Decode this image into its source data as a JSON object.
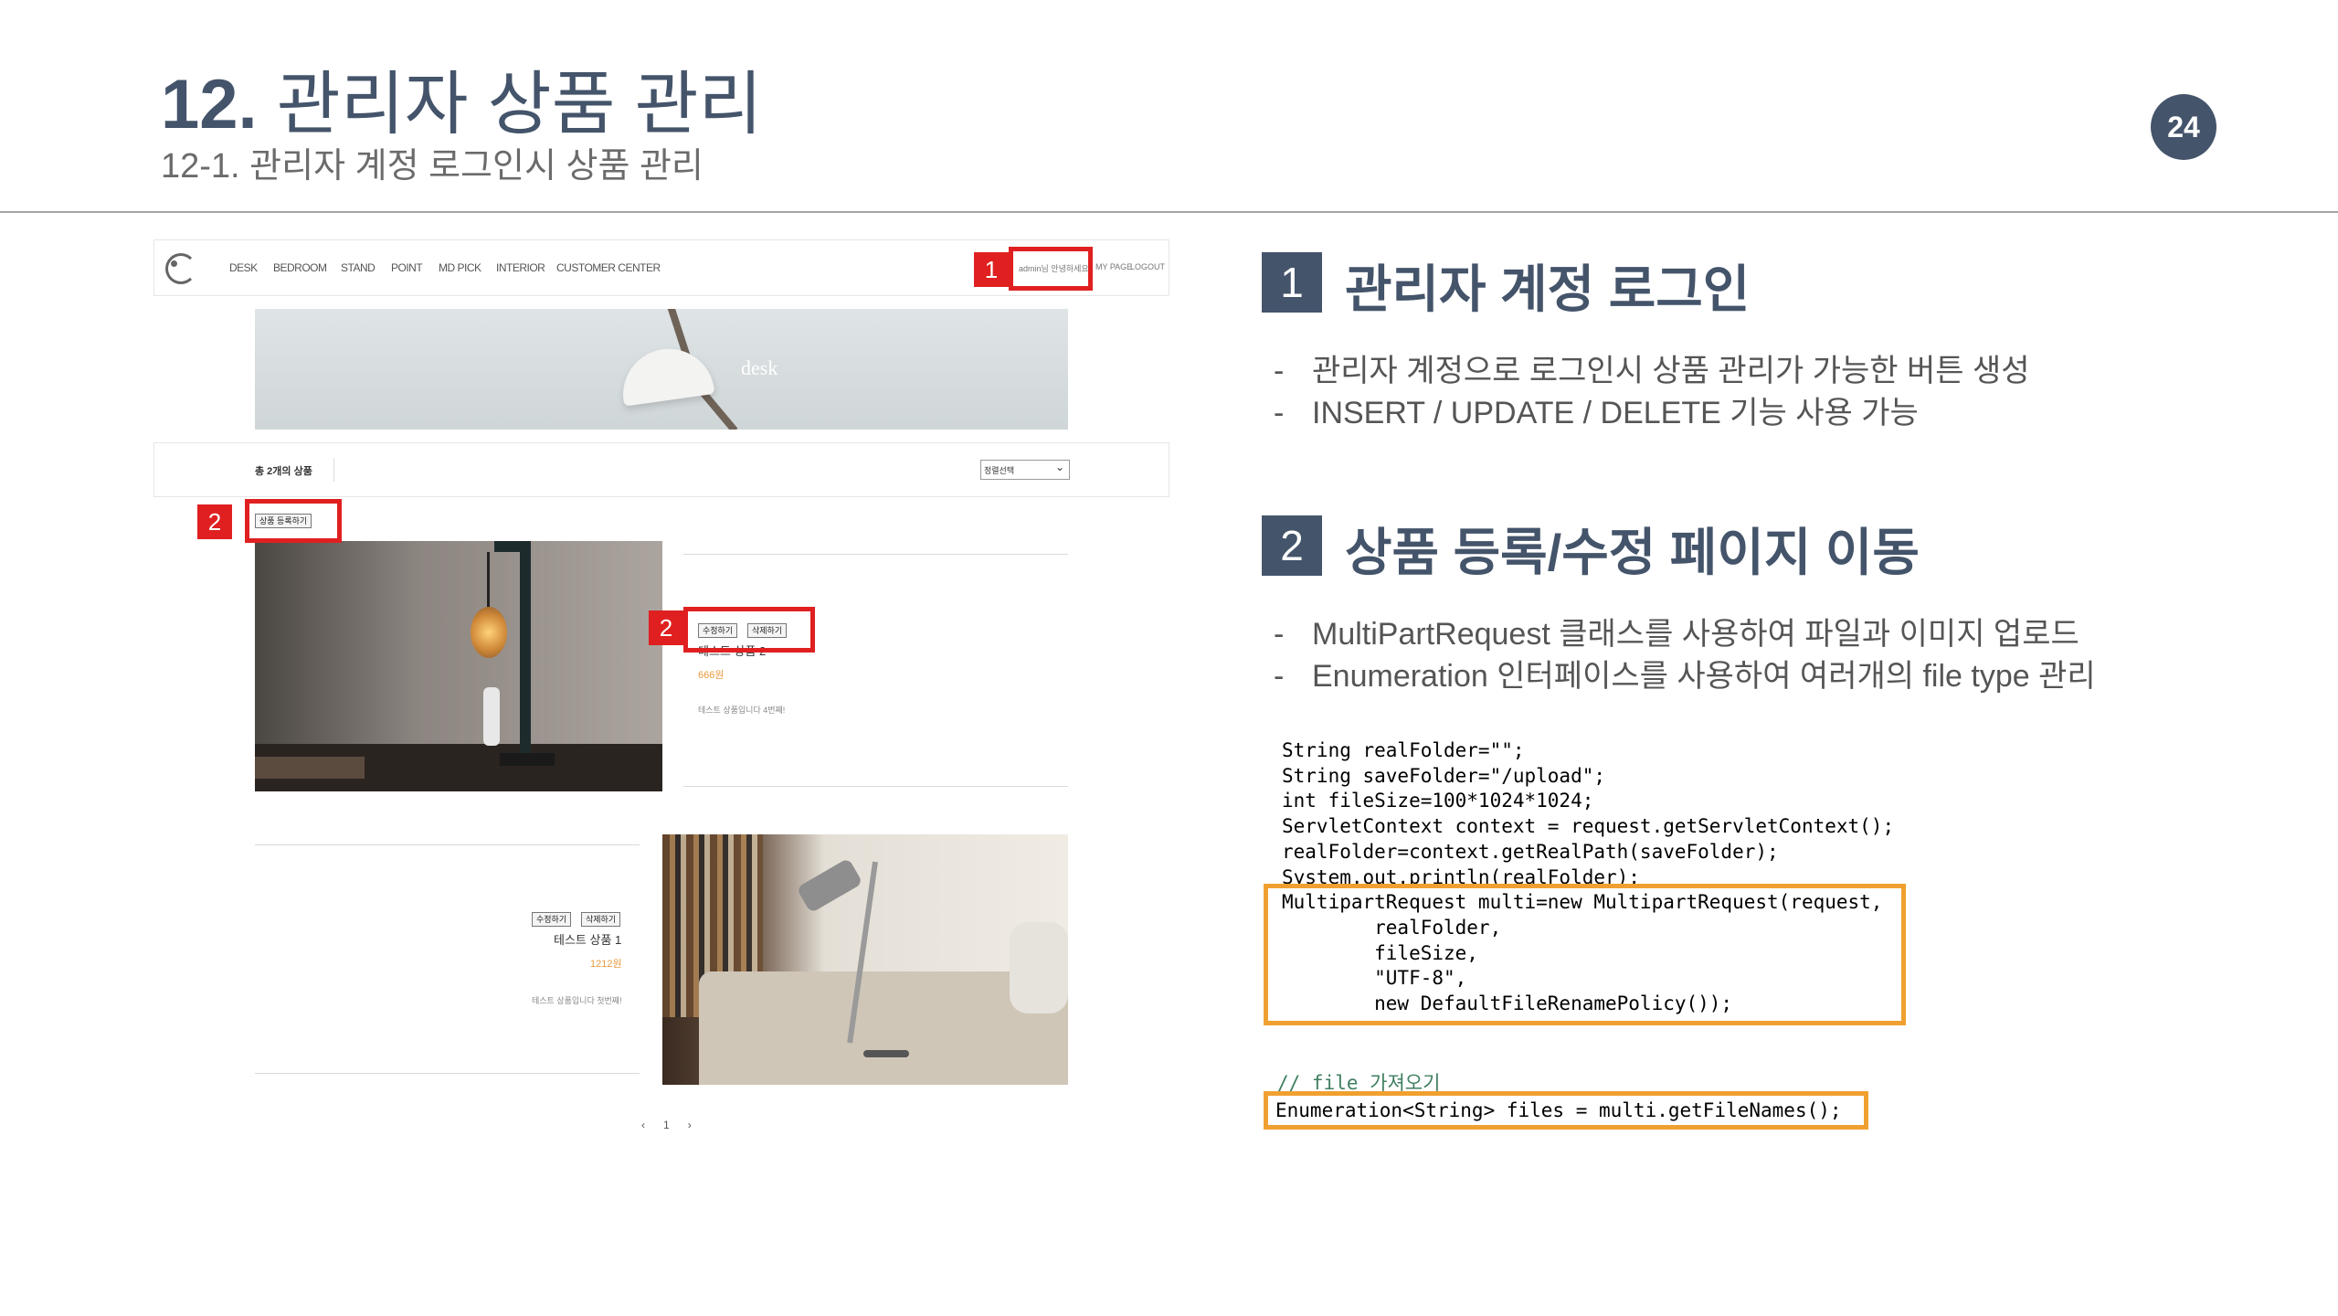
{
  "slide": {
    "number_bold": "12.",
    "title": "관리자 상품 관리",
    "subtitle": "12-1. 관리자 계정 로그인시 상품 관리",
    "page_number": "24"
  },
  "screenshot": {
    "nav": {
      "items": [
        "DESK",
        "BEDROOM",
        "STAND",
        "POINT",
        "MD PICK",
        "INTERIOR",
        "CUSTOMER CENTER"
      ],
      "user_greeting": "admin님 안녕하세요.",
      "mypage": "MY PAGE",
      "logout": "LOGOUT"
    },
    "hero_label": "desk",
    "product_count": "총 2개의 상품",
    "sort_select": "정렬선택",
    "register_button": "상품 등록하기",
    "products": [
      {
        "edit_button": "수정하기",
        "delete_button": "삭제하기",
        "name": "테스트 상품 2",
        "price": "666원",
        "desc": "테스트 상품입니다 4번째!"
      },
      {
        "edit_button": "수정하기",
        "delete_button": "삭제하기",
        "name": "테스트 상품 1",
        "price": "1212원",
        "desc": "테스트 상품입니다 첫번째!"
      }
    ],
    "pager": {
      "prev": "‹",
      "page": "1",
      "next": "›"
    },
    "markers": {
      "one": "1",
      "two": "2"
    }
  },
  "section1": {
    "number": "1",
    "title": "관리자 계정 로그인",
    "bullets": [
      "관리자 계정으로 로그인시 상품 관리가 가능한 버튼 생성",
      "INSERT / UPDATE / DELETE 기능 사용 가능"
    ]
  },
  "section2": {
    "number": "2",
    "title": "상품 등록/수정 페이지 이동",
    "bullets": [
      "MultiPartRequest 클래스를 사용하여 파일과 이미지 업로드",
      "Enumeration 인터페이스를 사용하여 여러개의 file type 관리"
    ]
  },
  "code": {
    "line1": "String realFolder=\"\";",
    "line2": "String saveFolder=\"/upload\";",
    "line3": "int fileSize=100*1024*1024;",
    "line4": "ServletContext context = request.getServletContext();",
    "line5": "realFolder=context.getRealPath(saveFolder);",
    "line6": "System.out.println(realFolder);",
    "line7": "MultipartRequest multi=new MultipartRequest(request,",
    "line8": "        realFolder,",
    "line9": "        fileSize,",
    "line10": "        \"UTF-8\",",
    "line11": "        new DefaultFileRenamePolicy());",
    "comment": "// file 가져오기",
    "line12": "Enumeration<String> files = multi.getFileNames();"
  },
  "colors": {
    "navy": "#44546a",
    "red": "#e02020",
    "orange": "#f0a030",
    "price": "#e89a3c"
  }
}
